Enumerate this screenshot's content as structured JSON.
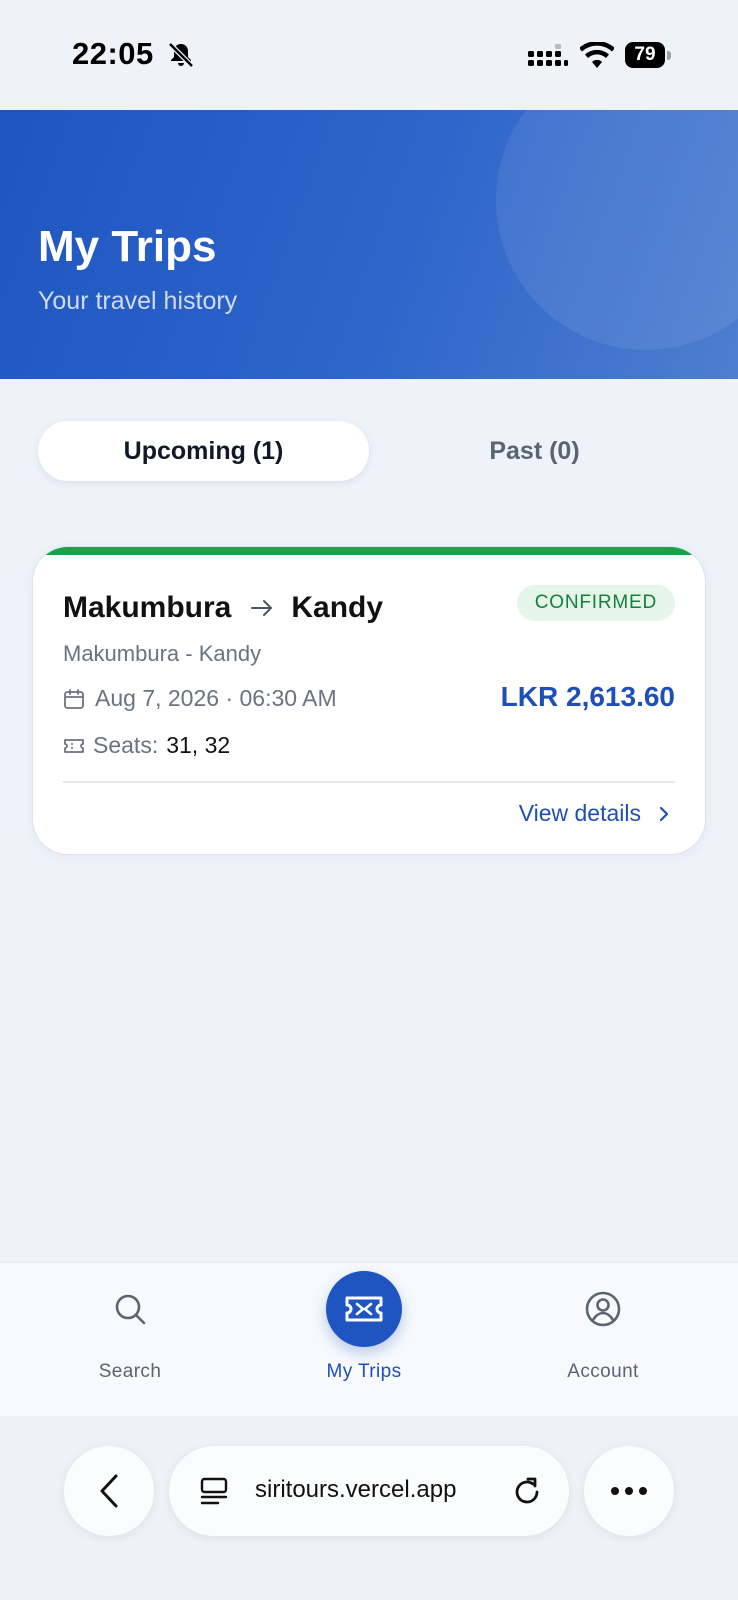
{
  "status_bar": {
    "time": "22:05",
    "battery": "79"
  },
  "header": {
    "title": "My Trips",
    "subtitle": "Your travel history"
  },
  "tabs": [
    {
      "label": "Upcoming (1)",
      "active": true
    },
    {
      "label": "Past (0)",
      "active": false
    }
  ],
  "trip": {
    "from": "Makumbura",
    "to": "Kandy",
    "route_name": "Makumbura - Kandy",
    "status": "CONFIRMED",
    "datetime": "Aug 7, 2026 · 06:30 AM",
    "price": "LKR 2,613.60",
    "seats_label": "Seats:",
    "seats": "31, 32",
    "view_details": "View details"
  },
  "bottom_nav": {
    "items": [
      {
        "label": "Search",
        "icon": "search-icon"
      },
      {
        "label": "My Trips",
        "icon": "ticket-icon",
        "active": true
      },
      {
        "label": "Account",
        "icon": "user-circle-icon"
      }
    ]
  },
  "browser": {
    "url": "siritours.vercel.app"
  },
  "colors": {
    "primary": "#1e55c0",
    "confirmed": "#16a34a",
    "price": "#1e4fb8"
  }
}
